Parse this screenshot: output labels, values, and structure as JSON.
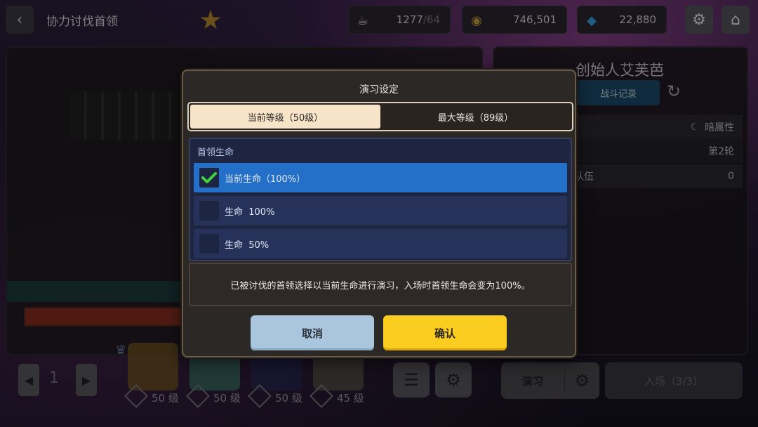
{
  "topbar": {
    "back_icon": "chevron-left-icon",
    "title": "协力讨伐首领",
    "stamina_current": "1277",
    "stamina_max": "/64",
    "gold": "746,501",
    "gems": "22,880",
    "settings_icon": "gear-icon",
    "home_icon": "home-icon"
  },
  "right_panel": {
    "boss_name": "创始人艾芙芭",
    "record_label": "战斗记录",
    "attribute": "暗属性",
    "round": "第2轮",
    "team_label": "队伍",
    "team_value": "0"
  },
  "dialog": {
    "title": "演习设定",
    "tabs": [
      {
        "label": "当前等级（50级）",
        "active": true
      },
      {
        "label": "最大等级（89级）",
        "active": false
      }
    ],
    "section_title": "首领生命",
    "options": [
      {
        "label": "当前生命（100%）",
        "selected": true
      },
      {
        "label": "生命  100%",
        "selected": false
      },
      {
        "label": "生命  50%",
        "selected": false
      }
    ],
    "description": "已被讨伐的首领选择以当前生命进行演习，入场时首领生命会变为100%。",
    "cancel_label": "取消",
    "confirm_label": "确认"
  },
  "bottom": {
    "page": "1",
    "heroes": [
      {
        "level": "50",
        "unit": "级"
      },
      {
        "level": "50",
        "unit": "级"
      },
      {
        "level": "50",
        "unit": "级"
      },
      {
        "level": "45",
        "unit": "级"
      }
    ],
    "drill_label": "演习",
    "enter_label": "入场（3/3）"
  },
  "colors": {
    "selected_option": "#2470c8",
    "confirm_button": "#fbcd21",
    "cancel_button": "#a9c6de",
    "check": "#3fd13f"
  }
}
